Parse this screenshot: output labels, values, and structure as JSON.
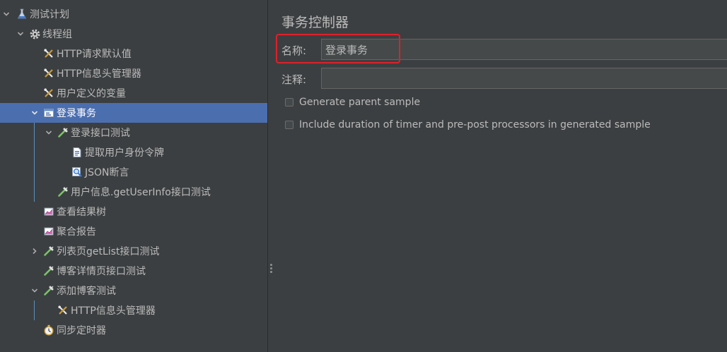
{
  "tree": {
    "items": [
      {
        "label": "测试计划",
        "icon": "test-plan-flask-icon",
        "expanded": true
      },
      {
        "label": "线程组",
        "icon": "thread-group-gear-icon",
        "expanded": true
      },
      {
        "label": "HTTP请求默认值",
        "icon": "config-tools-icon"
      },
      {
        "label": "HTTP信息头管理器",
        "icon": "config-tools-icon"
      },
      {
        "label": "用户定义的变量",
        "icon": "config-tools-icon"
      },
      {
        "label": "登录事务",
        "icon": "transaction-controller-icon",
        "expanded": true,
        "selected": true
      },
      {
        "label": "登录接口测试",
        "icon": "sampler-pipette-icon",
        "expanded": true
      },
      {
        "label": "提取用户身份令牌",
        "icon": "extractor-document-icon"
      },
      {
        "label": "JSON断言",
        "icon": "assertion-magnifier-icon"
      },
      {
        "label": "用户信息.getUserInfo接口测试",
        "icon": "sampler-pipette-icon"
      },
      {
        "label": "查看结果树",
        "icon": "listener-graph-icon"
      },
      {
        "label": "聚合报告",
        "icon": "listener-graph-icon"
      },
      {
        "label": "列表页getList接口测试",
        "icon": "sampler-pipette-icon",
        "expanded": false
      },
      {
        "label": "博客详情页接口测试",
        "icon": "sampler-pipette-icon"
      },
      {
        "label": "添加博客测试",
        "icon": "sampler-pipette-icon",
        "expanded": true
      },
      {
        "label": "HTTP信息头管理器",
        "icon": "config-tools-icon"
      },
      {
        "label": "同步定时器",
        "icon": "timer-stopwatch-icon"
      }
    ]
  },
  "panel": {
    "title": "事务控制器",
    "name_label": "名称:",
    "name_value": "登录事务",
    "comment_label": "注释:",
    "comment_value": "",
    "checkbox_generate_parent": "Generate parent sample",
    "checkbox_include_duration": "Include duration of timer and pre-post processors in generated sample"
  },
  "colors": {
    "background": "#3c3f41",
    "selection": "#4b6eaf",
    "highlight": "#e0202a",
    "text": "#bbbbbb"
  }
}
